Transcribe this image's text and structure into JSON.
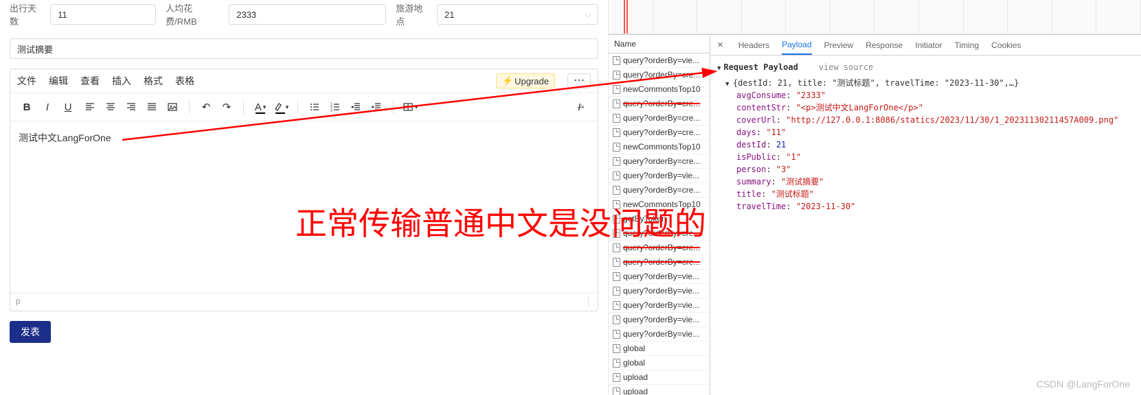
{
  "form": {
    "days_label": "出行天数",
    "days_value": "11",
    "cost_label": "人均花费/RMB",
    "cost_value": "2333",
    "dest_label": "旅游地点",
    "dest_value": "21",
    "summary_value": "测试摘要"
  },
  "editor": {
    "menus": [
      "文件",
      "编辑",
      "查看",
      "插入",
      "格式",
      "表格"
    ],
    "upgrade_label": "Upgrade",
    "more_label": "⋯",
    "content_text": "测试中文LangForOne",
    "status_path": "p"
  },
  "publish_label": "发表",
  "devtools": {
    "name_header": "Name",
    "requests": [
      {
        "label": "query?orderBy=vie...",
        "crossed": false
      },
      {
        "label": "query?orderBy=cre...",
        "crossed": false
      },
      {
        "label": "newCommontsTop10",
        "crossed": false
      },
      {
        "label": "query?orderBy=cre...",
        "crossed": true
      },
      {
        "label": "query?orderBy=cre...",
        "crossed": false
      },
      {
        "label": "query?orderBy=cre...",
        "crossed": false
      },
      {
        "label": "newCommontsTop10",
        "crossed": false
      },
      {
        "label": "query?orderBy=cre...",
        "crossed": false
      },
      {
        "label": "query?orderBy=vie...",
        "crossed": false
      },
      {
        "label": "query?orderBy=cre...",
        "crossed": false
      },
      {
        "label": "newCommontsTop10",
        "crossed": false
      },
      {
        "label": "getByToken",
        "crossed": false
      },
      {
        "label": "query?orderBy=cre...",
        "crossed": true
      },
      {
        "label": "query?orderBy=cre...",
        "crossed": true
      },
      {
        "label": "query?orderBy=cre...",
        "crossed": true
      },
      {
        "label": "query?orderBy=vie...",
        "crossed": false
      },
      {
        "label": "query?orderBy=vie...",
        "crossed": false
      },
      {
        "label": "query?orderBy=vie...",
        "crossed": false
      },
      {
        "label": "query?orderBy=vie...",
        "crossed": false
      },
      {
        "label": "query?orderBy=vie...",
        "crossed": false
      },
      {
        "label": "global",
        "crossed": false
      },
      {
        "label": "global",
        "crossed": false
      },
      {
        "label": "upload",
        "crossed": false
      },
      {
        "label": "upload",
        "crossed": false
      }
    ],
    "tabs": [
      "Headers",
      "Payload",
      "Preview",
      "Response",
      "Initiator",
      "Timing",
      "Cookies"
    ],
    "active_tab": "Payload",
    "payload_title": "Request Payload",
    "view_source": "view source",
    "summary_line": "{destId: 21, title: \"测试标题\", travelTime: \"2023-11-30\",…}",
    "fields": [
      {
        "k": "avgConsume",
        "v": "\"2333\"",
        "t": "str"
      },
      {
        "k": "contentStr",
        "v": "\"<p>测试中文LangForOne</p>\"",
        "t": "str"
      },
      {
        "k": "coverUrl",
        "v": "\"http://127.0.0.1:8086/statics/2023/11/30/1_20231130211457A009.png\"",
        "t": "str"
      },
      {
        "k": "days",
        "v": "\"11\"",
        "t": "str"
      },
      {
        "k": "destId",
        "v": "21",
        "t": "num"
      },
      {
        "k": "isPublic",
        "v": "\"1\"",
        "t": "str"
      },
      {
        "k": "person",
        "v": "\"3\"",
        "t": "str"
      },
      {
        "k": "summary",
        "v": "\"测试摘要\"",
        "t": "str"
      },
      {
        "k": "title",
        "v": "\"测试标题\"",
        "t": "str"
      },
      {
        "k": "travelTime",
        "v": "\"2023-11-30\"",
        "t": "str"
      }
    ]
  },
  "annotation_text": "正常传输普通中文是没问题的",
  "watermark": "CSDN @LangForOne"
}
